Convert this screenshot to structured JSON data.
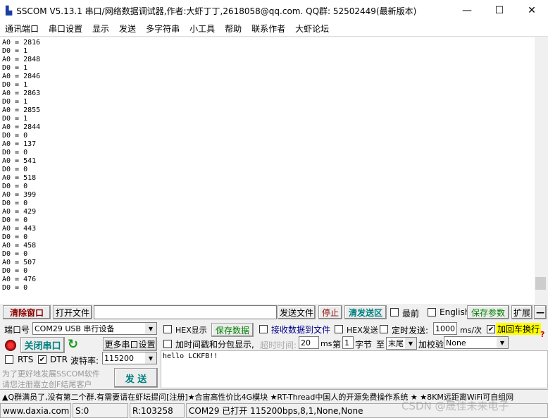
{
  "window": {
    "title": "SSCOM V5.13.1 串口/网络数据调试器,作者:大虾丁丁,2618058@qq.com. QQ群: 52502449(最新版本)",
    "minimize": "—",
    "maximize": "☐",
    "close": "✕"
  },
  "menu": [
    "通讯端口",
    "串口设置",
    "显示",
    "发送",
    "多字符串",
    "小工具",
    "帮助",
    "联系作者",
    "大虾论坛"
  ],
  "log": [
    "A0 = 2816",
    "D0 = 1",
    "A0 = 2848",
    "D0 = 1",
    "A0 = 2846",
    "D0 = 1",
    "A0 = 2863",
    "D0 = 1",
    "A0 = 2855",
    "D0 = 1",
    "A0 = 2844",
    "D0 = 0",
    "A0 = 137",
    "D0 = 0",
    "A0 = 541",
    "D0 = 0",
    "A0 = 518",
    "D0 = 0",
    "A0 = 399",
    "D0 = 0",
    "A0 = 429",
    "D0 = 0",
    "A0 = 443",
    "D0 = 0",
    "A0 = 458",
    "D0 = 0",
    "A0 = 507",
    "D0 = 0",
    "A0 = 476",
    "D0 = 0"
  ],
  "toolbar": {
    "clear": "清除窗口",
    "open_file": "打开文件",
    "file_path": "",
    "send_file": "发送文件",
    "stop": "停止",
    "clear_send": "清发送区",
    "topmost": "最前",
    "english": "English",
    "save_params": "保存参数",
    "expand": "扩展",
    "collapse": "—"
  },
  "port": {
    "label": "端口号",
    "value": "COM29 USB 串行设备",
    "close_port": "关闭串口",
    "more_settings": "更多串口设置",
    "rts": "RTS",
    "dtr": "DTR",
    "dtr_checked": true,
    "rts_checked": false,
    "baud_label": "波特率:",
    "baud": "115200",
    "promo1": "为了更好地发展SSCOM软件",
    "promo2": "请您注册嘉立创F结尾客户",
    "send": "发  送"
  },
  "options": {
    "hex_display": "HEX显示",
    "save_data": "保存数据",
    "recv_to_file": "接收数据到文件",
    "hex_send": "HEX发送",
    "timed_send": "定时发送:",
    "interval": "1000",
    "interval_unit": "ms/次",
    "append_crlf": "加回车换行",
    "append_crlf_checked": true,
    "timestamp": "加时间戳和分包显示,",
    "timeout_label": "超时时间:",
    "timeout": "20",
    "timeout_unit": "ms",
    "nth": "第",
    "byte_start": "1",
    "byte_unit": "字节",
    "to": "至",
    "byte_end": "末尾",
    "checksum_label": "加校验",
    "checksum": "None",
    "help": "?"
  },
  "send_text": "hello LCKFB!!",
  "marquee": "▲Q群满员了,没有第二个群.有需要请在虾坛提问[注册]★合宙高性价比4G模块 ★RT-Thread中国人的开源免费操作系统 ★ ★8KM远距离WiFi可自组网",
  "statusbar": {
    "site": "www.daxia.com",
    "sent": "S:0",
    "received": "R:103258",
    "port_status": "COM29 已打开  115200bps,8,1,None,None"
  },
  "watermark": "CSDN @晟佳未来电子",
  "colors": {
    "clear_btn": "#8b0000",
    "close_port": "#008080",
    "save_green": "#008000",
    "highlight": "#ffff00",
    "link_blue": "#00008b"
  }
}
